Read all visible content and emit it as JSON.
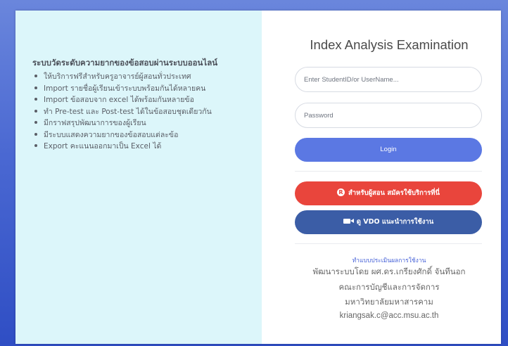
{
  "info": {
    "heading": "ระบบวัดระดับความยากของข้อสอบผ่านระบบออนไลน์",
    "features": [
      "ให้บริการฟรีสำหรับครูอาจารย์ผู้สอนทั่วประเทศ",
      "Import รายชื่อผู้เรียนเข้าระบบพร้อมกันได้หลายคน",
      "Import ข้อสอบจาก excel ได้พร้อมกันหลายข้อ",
      "ทำ Pre-test และ Post-test ได้ในข้อสอบชุดเดียวกัน",
      "มีกราฟสรุปพัฒนาการของผู้เรียน",
      "มีระบบแสดงความยากของข้อสอบแต่ละข้อ",
      "Export คะแนนออกมาเป็น Excel ได้"
    ]
  },
  "login": {
    "title": "Index Analysis Examination",
    "username_placeholder": "Enter StudentID/or UserName...",
    "password_placeholder": "Password",
    "login_label": "Login",
    "register_icon": "registered-icon",
    "register_label": "สำหรับผู้สอน สมัครใช้บริการที่นี่",
    "vdo_icon": "video-camera-icon",
    "vdo_label": "ดู VDO แนะนำการใช้งาน"
  },
  "footer": {
    "survey_link": "ทำแบบประเมินผลการใช้งาน",
    "developer": "พัฒนาระบบโดย ผศ.ดร.เกรียงศักดิ์ จันทีนอก",
    "faculty": "คณะการบัญชีและการจัดการ",
    "university": "มหาวิทยาลัยมหาสารคาม",
    "email": "kriangsak.c@acc.msu.ac.th"
  },
  "colors": {
    "background_blue": "#4a68d2",
    "panel_cyan": "#dcf6fa",
    "login_button": "#5b78e3",
    "register_button": "#e9453c",
    "vdo_button": "#3b5da6",
    "link": "#4863d8"
  }
}
